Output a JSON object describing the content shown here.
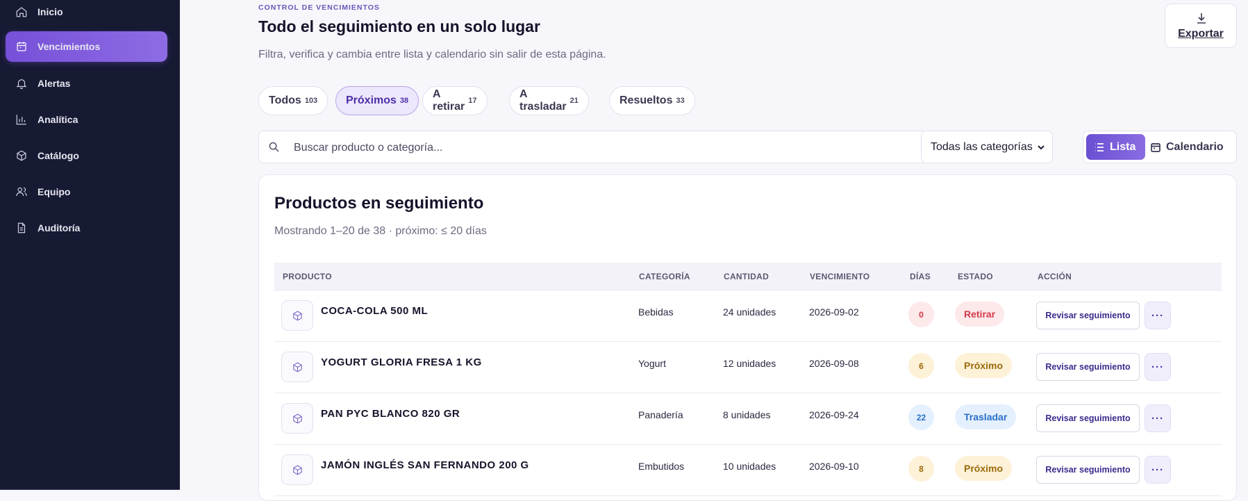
{
  "sidebar": {
    "items": [
      {
        "label": "Inicio",
        "icon": "home-icon"
      },
      {
        "label": "Vencimientos",
        "icon": "calendar-icon",
        "active": true
      },
      {
        "label": "Alertas",
        "icon": "bell-icon"
      },
      {
        "label": "Analítica",
        "icon": "bar-chart-icon"
      },
      {
        "label": "Catálogo",
        "icon": "box-icon"
      },
      {
        "label": "Equipo",
        "icon": "users-icon"
      },
      {
        "label": "Auditoría",
        "icon": "file-icon"
      }
    ]
  },
  "header": {
    "eyebrow": "CONTROL DE VENCIMIENTOS",
    "title": "Todo el seguimiento en un solo lugar",
    "subtitle": "Filtra, verifica y cambia entre lista y calendario sin salir de esta página.",
    "export_label": "Exportar"
  },
  "tabs": [
    {
      "label": "Todos",
      "count": "103"
    },
    {
      "label": "Próximos",
      "count": "38",
      "active": true
    },
    {
      "label": "A retirar",
      "count": "17"
    },
    {
      "label": "A trasladar",
      "count": "21"
    },
    {
      "label": "Resueltos",
      "count": "33"
    }
  ],
  "filters": {
    "search_placeholder": "Buscar producto o categoría...",
    "category_selected": "Todas las categorías",
    "view_list_label": "Lista",
    "view_calendar_label": "Calendario"
  },
  "table": {
    "title": "Productos en seguimiento",
    "subtitle": "Mostrando 1–20 de 38 · próximo: ≤ 20 días",
    "columns": [
      "PRODUCTO",
      "CATEGORÍA",
      "CANTIDAD",
      "VENCIMIENTO",
      "DÍAS",
      "ESTADO",
      "ACCIÓN"
    ],
    "action_label": "Revisar seguimiento",
    "more_label": "···",
    "rows": [
      {
        "product": "COCA-COLA 500 ML",
        "category": "Bebidas",
        "quantity": "24 unidades",
        "expiry": "2026-09-02",
        "days": "0",
        "status": "Retirar"
      },
      {
        "product": "YOGURT GLORIA FRESA 1 KG",
        "category": "Yogurt",
        "quantity": "12 unidades",
        "expiry": "2026-09-08",
        "days": "6",
        "status": "Próximo"
      },
      {
        "product": "PAN PYC BLANCO 820 GR",
        "category": "Panadería",
        "quantity": "8 unidades",
        "expiry": "2026-09-24",
        "days": "22",
        "status": "Trasladar"
      },
      {
        "product": "JAMÓN INGLÉS SAN FERNANDO 200 G",
        "category": "Embutidos",
        "quantity": "10 unidades",
        "expiry": "2026-09-10",
        "days": "8",
        "status": "Próximo"
      }
    ]
  },
  "colors": {
    "sidebar_bg": "#171a33",
    "accent": "#7650d8",
    "status_retirar_bg": "#fde8ea",
    "status_retirar_fg": "#d23a4a",
    "status_proximo_bg": "#fdf1d8",
    "status_proximo_fg": "#9a6a08",
    "status_trasladar_bg": "#e4f0fd",
    "status_trasladar_fg": "#2a6fc9"
  }
}
